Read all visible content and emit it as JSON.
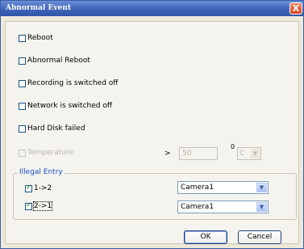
{
  "window": {
    "title": "Abnormal Event",
    "close_glyph": "X"
  },
  "events": [
    {
      "label": "Reboot",
      "checked": false
    },
    {
      "label": "Abnormal Reboot",
      "checked": false
    },
    {
      "label": "Recording is switched off",
      "checked": false
    },
    {
      "label": "Network is switched off",
      "checked": false
    },
    {
      "label": "Hard Disk failed",
      "checked": false
    }
  ],
  "temperature": {
    "label": "Temperature",
    "enabled": false,
    "operator": ">",
    "value": "50",
    "degree_symbol": "0",
    "unit": "C",
    "unit_arrow": "▼"
  },
  "illegal_entry": {
    "title": "Illegal Entry",
    "rows": [
      {
        "label": "1->2",
        "checked": true,
        "camera": "Camera1",
        "arrow": "▼"
      },
      {
        "label": "2->1",
        "checked": true,
        "camera": "Camera1",
        "arrow": "▼"
      }
    ]
  },
  "buttons": {
    "ok": "OK",
    "cancel": "Cancel"
  }
}
